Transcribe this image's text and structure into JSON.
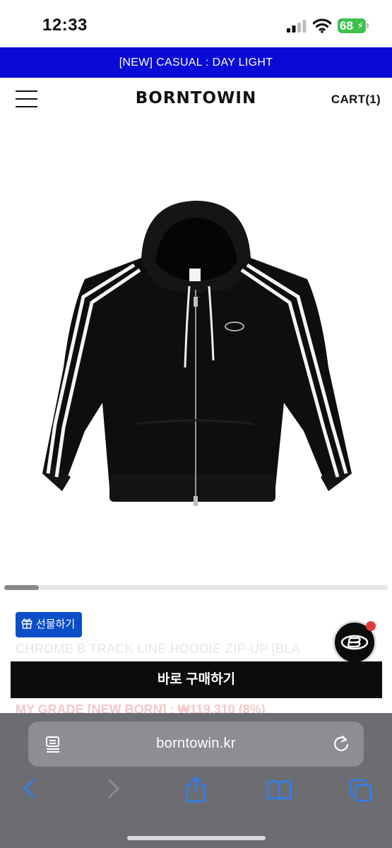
{
  "status_bar": {
    "time": "12:33",
    "battery_level": "68",
    "icons": [
      "signal-icon",
      "wifi-icon",
      "battery-icon"
    ]
  },
  "promo_banner": {
    "text": "[NEW] CASUAL : DAY LIGHT",
    "color": "#0a0ad6"
  },
  "header": {
    "logo": "BORNTOWIN",
    "cart_label": "CART(1)",
    "menu_icon": "hamburger-menu-icon"
  },
  "product": {
    "image_icon": "black-track-hoodie-image",
    "carousel_position": 0.09,
    "gift_label": "선물하기",
    "title": "CHROME B TRACK LINE HOODIE ZIP-UP [BLA",
    "buy_label": "바로 구매하기",
    "grade_text": "MY GRADE [NEW BORN] : ₩119,310 (8%)"
  },
  "browser": {
    "url": "borntowin.kr",
    "nav_icons": [
      "back-icon",
      "forward-icon",
      "share-icon",
      "bookmarks-icon",
      "tabs-icon"
    ],
    "accent": "#2f80ed"
  }
}
